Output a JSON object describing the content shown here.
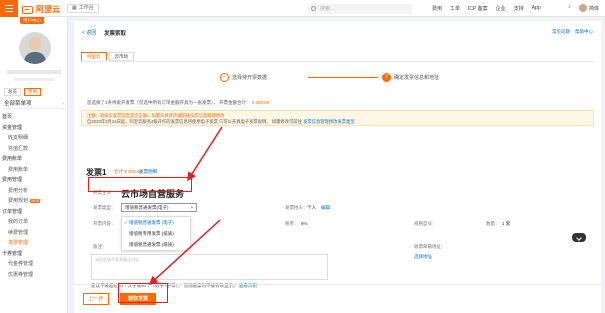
{
  "topbar": {
    "logo_text": "阿里云",
    "workbench": "工作台",
    "search_placeholder": "搜索...",
    "nav": [
      "费用",
      "工单",
      "ICP 备案",
      "企业",
      "支持",
      "App"
    ],
    "user_name": "简体"
  },
  "sidebar": {
    "badge": "用户中心",
    "tabs": [
      "总览",
      "费用"
    ],
    "all_menu": "全部菜单项",
    "items": [
      {
        "label": "首页",
        "group": true
      },
      {
        "label": "资金管理",
        "group": true
      },
      {
        "label": "收支明细",
        "group": false
      },
      {
        "label": "充值汇款",
        "group": false
      },
      {
        "label": "费用账单",
        "group": true
      },
      {
        "label": "费用账单",
        "group": false
      },
      {
        "label": "费用管理",
        "group": true
      },
      {
        "label": "费用分析",
        "group": false
      },
      {
        "label": "费用规划",
        "group": false,
        "badge": "NEW"
      },
      {
        "label": "订单管理",
        "group": true
      },
      {
        "label": "我的订单",
        "group": false
      },
      {
        "label": "续费管理",
        "group": false
      },
      {
        "label": "发票管理",
        "group": false
      },
      {
        "label": "卡券管理",
        "group": true
      },
      {
        "label": "代金券管理",
        "group": false
      },
      {
        "label": "优惠券管理",
        "group": false
      }
    ]
  },
  "page": {
    "back": "< 返回",
    "title": "发票索取",
    "links": [
      "常见问题",
      "帮助中心"
    ],
    "tabs": [
      "阿里云",
      "云市场"
    ],
    "steps": [
      {
        "num": "✓",
        "label": "选择待开票数据"
      },
      {
        "num": "2",
        "label": "确定发票信息和地址"
      }
    ],
    "summary_prefix": "您选择了1条待索开发票（仅选中所有订单金额开具为一张发票）， 开票金额合计：",
    "summary_amount": "¥ 300.00",
    "notice_warn": "注意：请核实发票信息是否正确，如需开具修改请前往发票信息管理修改",
    "notice_text": "自2020年3月24日起，阿里云服务4级开作的发票信息将使用电子发票 只可以开具电子发票说明。 如需修改可前往",
    "notice_link": "发票信息管理修改发票类型"
  },
  "invoice": {
    "title": "发票1",
    "amount": "合计 ¥ 300.00",
    "amount_link": "发票明细",
    "label_header": "开票主体：",
    "company": "云市场自营服务",
    "label_type": "发票类型：",
    "type_value": "增值税普通发票(电子)",
    "label_title_type": "发票抬头：",
    "title_type_value": "个人",
    "edit_link": "编辑",
    "label_content": "开票内容：",
    "label_rate": "税率：",
    "rate_value": "6%",
    "label_spec": "规格型号：",
    "label_qty": "数量：",
    "qty_value": "1 套",
    "dropdown_options": [
      {
        "label": "增值税普通发票 (电子)",
        "selected": true
      },
      {
        "label": "增值税专用发票 (纸质)",
        "selected": false
      },
      {
        "label": "增值税普通发票 (纸质)",
        "selected": false
      }
    ],
    "label_notes": "备注：",
    "notes_placeholder": "请在此填写发票备注内容",
    "label_addr": "收票邮箱地址：",
    "addr_link": "选择地址",
    "hint": "建议不要超过20个汉字或50个（数字+字母）， 否则备案时不被有效显示。",
    "hint_link": "查看示例"
  },
  "buttons": {
    "prev": "上一步",
    "submit": "索取发票"
  },
  "colors": {
    "brand": "#ff6a00",
    "link": "#0070cc",
    "annotation": "#e02020"
  }
}
